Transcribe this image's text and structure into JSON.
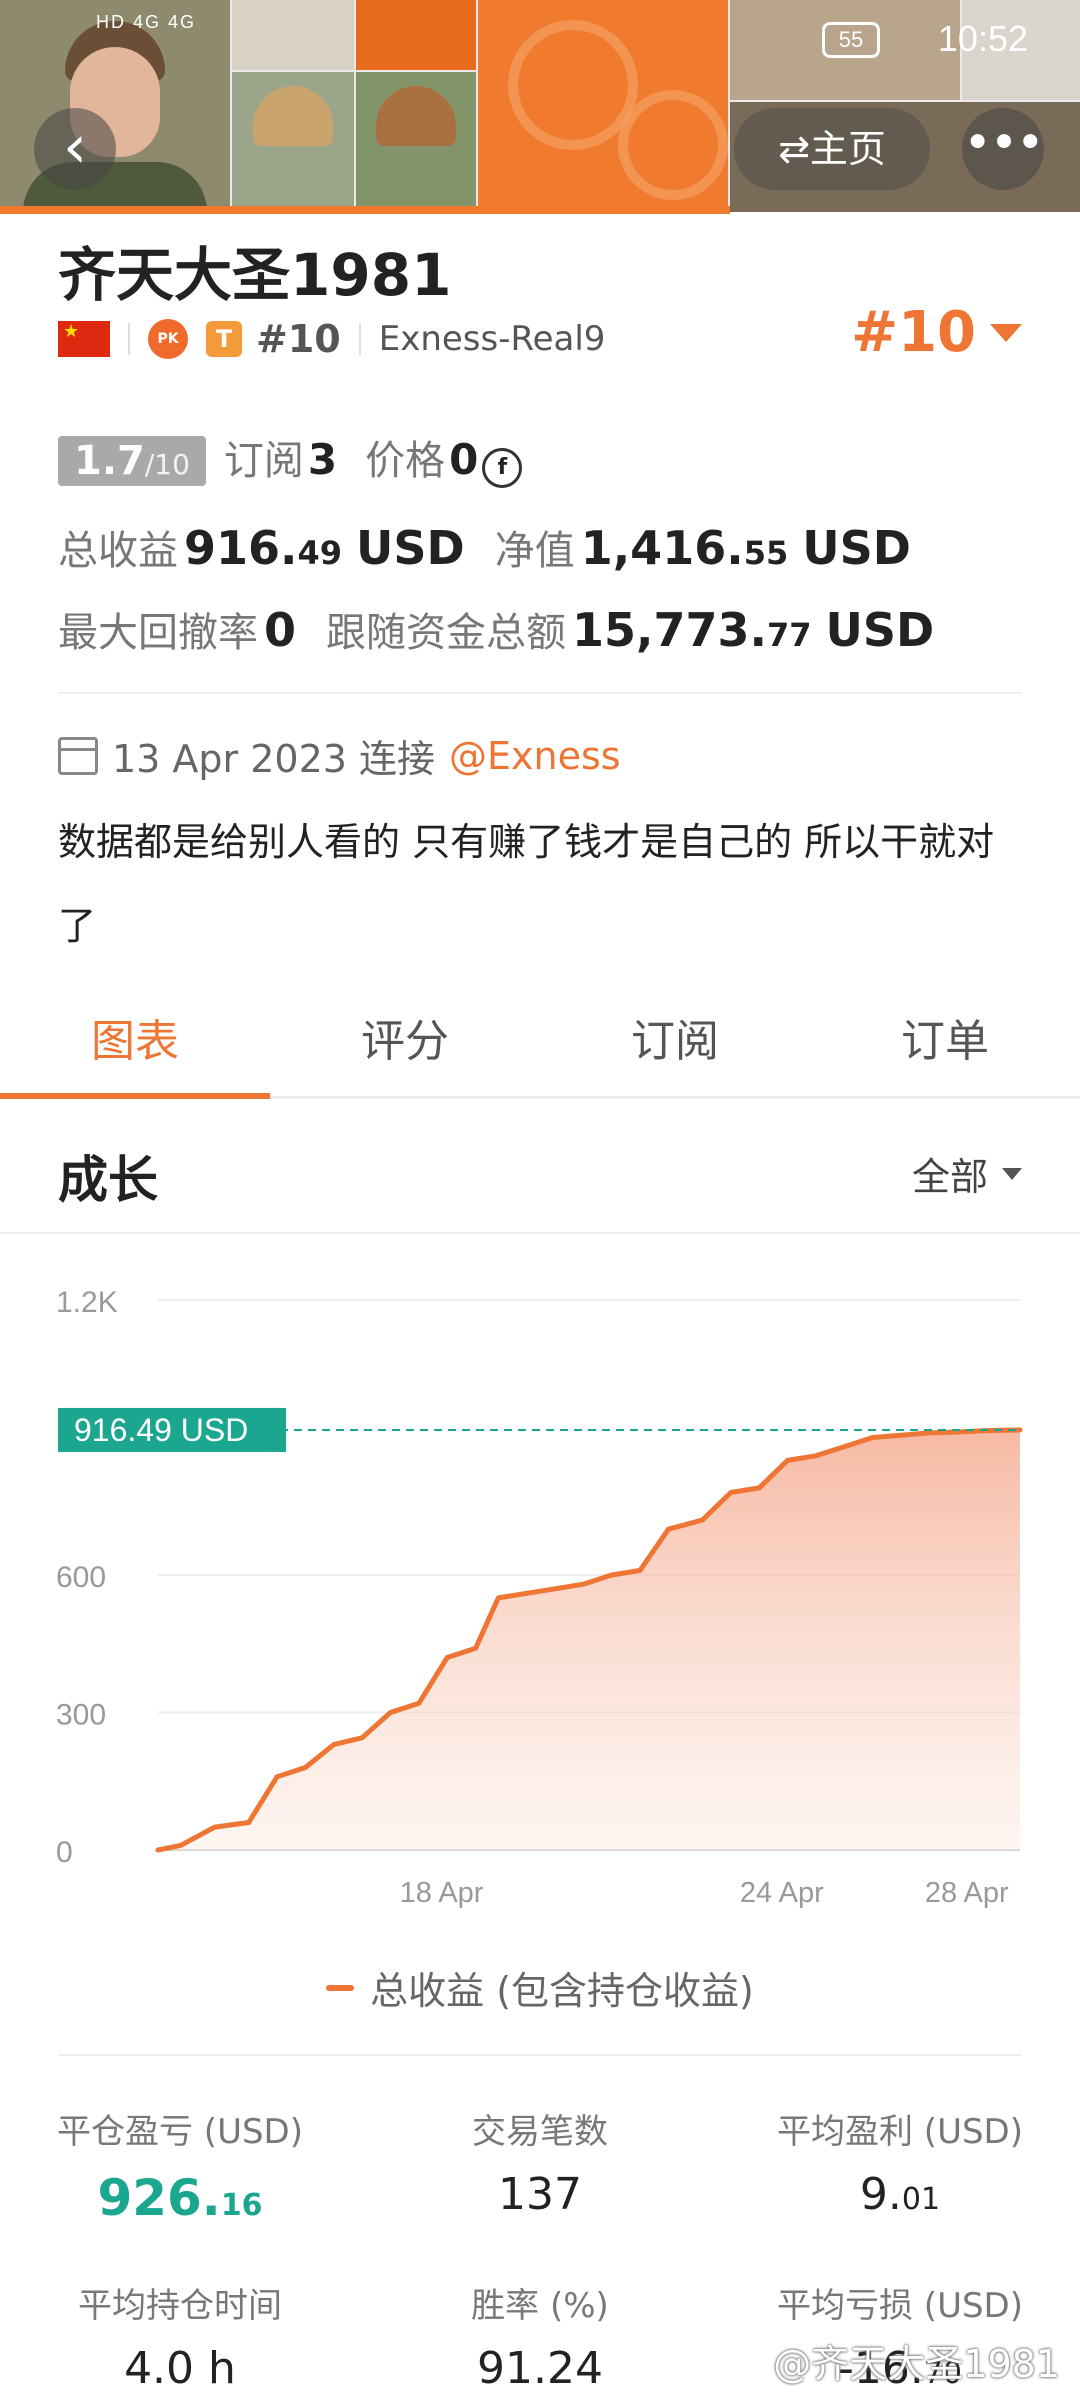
{
  "status_bar": {
    "signal_text": "HD 4G 4G",
    "battery": "55",
    "time": "10:52"
  },
  "nav": {
    "back_icon": "‹",
    "home_label": "⇄主页",
    "more_icon": "•••"
  },
  "profile": {
    "name": "齐天大圣1981",
    "pk_badge": "PK",
    "t_badge": "T",
    "rank_small": "#10",
    "broker": "Exness-Real9",
    "rank_big": "#10"
  },
  "stats_top": {
    "rating_main": "1.7",
    "rating_den": "/10",
    "subscribe_label": "订阅",
    "subscribe_value": "3",
    "price_label": "价格",
    "price_value": "0",
    "coin_symbol": "f",
    "total_profit_label": "总收益",
    "total_profit_int": "916.",
    "total_profit_dec": "49",
    "total_profit_unit": "USD",
    "equity_label": "净值",
    "equity_int": "1,416.",
    "equity_dec": "55",
    "equity_unit": "USD",
    "drawdown_label": "最大回撤率",
    "drawdown_value": "0",
    "follow_label": "跟随资金总额",
    "follow_int": "15,773.",
    "follow_dec": "77",
    "follow_unit": "USD"
  },
  "connection": {
    "date": "13 Apr 2023 连接",
    "broker_link": "@Exness"
  },
  "bio": "数据都是给别人看的 只有赚了钱才是自己的 所以干就对了",
  "tabs": [
    "图表",
    "评分",
    "订阅",
    "订单"
  ],
  "section": {
    "title": "成长",
    "filter": "全部"
  },
  "chart_data": {
    "type": "area",
    "y_ticks": [
      "0",
      "300",
      "600",
      "1.2K"
    ],
    "x_ticks": [
      {
        "label": "18 Apr",
        "x": 5
      },
      {
        "label": "24 Apr",
        "x": 11
      },
      {
        "label": "28 Apr",
        "x": 15
      }
    ],
    "ylim": [
      0,
      1200
    ],
    "xlim": [
      0,
      15.2
    ],
    "current_label": "916.49 USD",
    "current_value": 916.49,
    "series": [
      {
        "name": "总收益 (包含持仓收益)",
        "color": "#ee7533",
        "x": [
          0,
          0.4,
          1.0,
          1.6,
          2.1,
          2.6,
          3.1,
          3.6,
          4.1,
          4.6,
          5.1,
          5.6,
          6.0,
          6.5,
          7.0,
          7.5,
          8.0,
          8.5,
          9.0,
          9.6,
          10.1,
          10.6,
          11.1,
          11.6,
          12.1,
          12.6,
          13.1,
          13.6,
          14.1,
          14.6,
          15.2
        ],
        "y": [
          0,
          10,
          50,
          60,
          160,
          180,
          230,
          245,
          300,
          320,
          420,
          440,
          550,
          560,
          570,
          580,
          600,
          610,
          700,
          720,
          780,
          790,
          850,
          860,
          880,
          900,
          905,
          910,
          912,
          915,
          916.49
        ]
      }
    ],
    "legend": "总收益 (包含持仓收益)"
  },
  "stats_grid": [
    {
      "key": "平仓盈亏 (USD)",
      "int": "926.",
      "dec": "16",
      "teal": true
    },
    {
      "key": "交易笔数",
      "int": "137",
      "dec": "",
      "teal": false
    },
    {
      "key": "平均盈利 (USD)",
      "int": "9.",
      "dec": "01",
      "teal": false
    },
    {
      "key": "平均持仓时间",
      "int": "4.0 h",
      "dec": "",
      "teal": false
    },
    {
      "key": "胜率 (%)",
      "int": "91.24",
      "dec": "",
      "teal": false
    },
    {
      "key": "平均亏损 (USD)",
      "int": "-16.",
      "dec": "70",
      "teal": false
    }
  ],
  "watermark": "@齐天大圣1981"
}
